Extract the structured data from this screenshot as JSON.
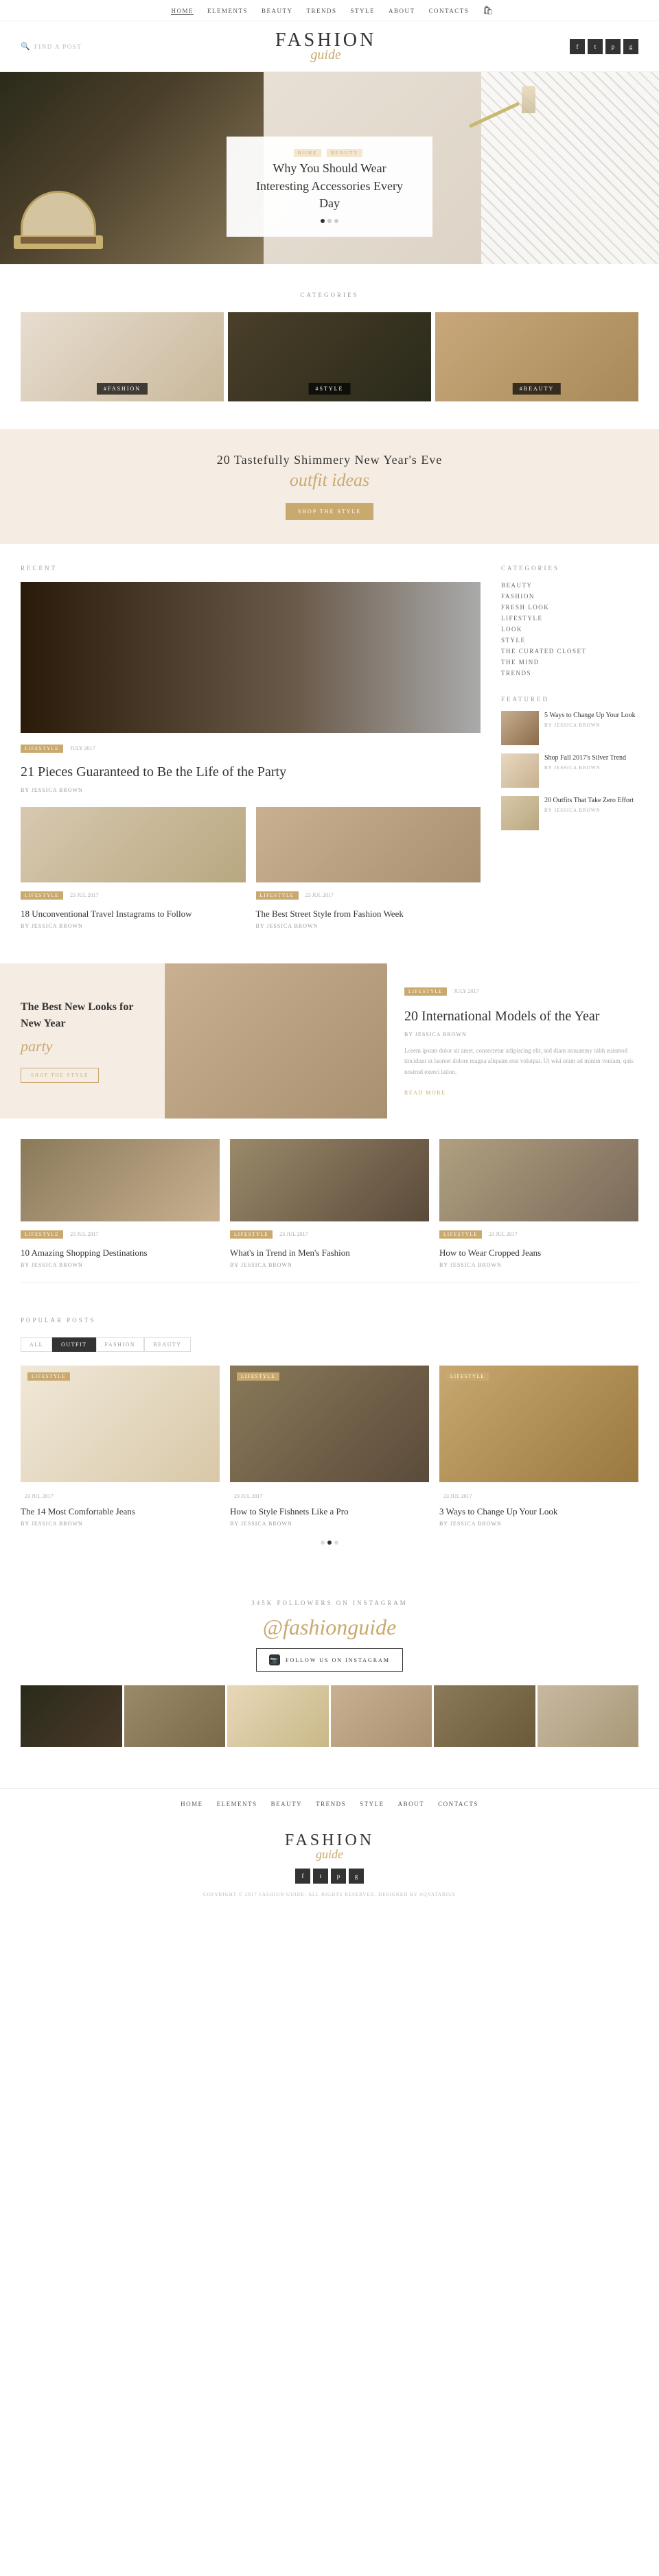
{
  "site": {
    "name": "FASHION",
    "script": "guide",
    "tagline": "345K FOLLOWERS ON INSTAGRAM",
    "instagram_handle": "@fashionguide"
  },
  "top_nav": {
    "items": [
      {
        "label": "HOME",
        "active": true
      },
      {
        "label": "ELEMENTS",
        "active": false
      },
      {
        "label": "BEAUTY",
        "active": false
      },
      {
        "label": "TRENDS",
        "active": false
      },
      {
        "label": "STYLE",
        "active": false
      },
      {
        "label": "ABOUT",
        "active": false
      },
      {
        "label": "CONTACTS",
        "active": false
      }
    ],
    "cart_icon": "🛍"
  },
  "header": {
    "search_placeholder": "FIND A POST",
    "social_icons": [
      "f",
      "t",
      "p",
      "g"
    ]
  },
  "hero": {
    "badge_home": "HOME",
    "badge_beauty": "BEAUTY",
    "title": "Why You Should Wear Interesting Accessories Every Day",
    "dots": 3,
    "active_dot": 0
  },
  "categories_section": {
    "label": "CATEGORIES",
    "items": [
      {
        "tag": "#FASHION",
        "color_class": "cat-img-fashion"
      },
      {
        "tag": "#STYLE",
        "color_class": "cat-img-style"
      },
      {
        "tag": "#BEAUTY",
        "color_class": "cat-img-beauty"
      }
    ]
  },
  "promo_banner": {
    "title": "20 Tastefully Shimmery New Year's Eve",
    "script": "outfit ideas",
    "button": "SHOP THE STYLE"
  },
  "recent_section": {
    "label": "RECENT",
    "featured_article": {
      "tag": "LIFESTYLE",
      "date": "JULY 2017",
      "title": "21 Pieces Guaranteed to Be the Life of the Party",
      "author": "BY JESSICA BROWN"
    },
    "two_col_articles": [
      {
        "tag": "LIFESTYLE",
        "date": "23 JUL 2017",
        "title": "18 Unconventional Travel Instagrams to Follow",
        "author": "BY JESSICA BROWN",
        "img_class": "img-travel"
      },
      {
        "tag": "LIFESTYLE",
        "date": "23 JUL 2017",
        "title": "The Best Street Style from Fashion Week",
        "author": "BY JESSICA BROWN",
        "img_class": "img-fashion"
      }
    ]
  },
  "sidebar": {
    "categories_label": "CATEGORIES",
    "categories": [
      "BEAUTY",
      "FASHION",
      "FRESH LOOK",
      "LIFESTYLE",
      "LOOK",
      "STYLE",
      "THE CURATED CLOSET",
      "THE MIND",
      "TRENDS"
    ],
    "featured_label": "FEATURED",
    "featured_items": [
      {
        "title": "5 Ways to Change Up Your Look",
        "author": "BY JESSICA BROWN",
        "thumb_class": "thumb-1"
      },
      {
        "title": "Shop Fall 2017's Silver Trend",
        "author": "BY JESSICA BROWN",
        "thumb_class": "thumb-2"
      },
      {
        "title": "20 Outfits That Take Zero Effort",
        "author": "BY JESSICA BROWN",
        "thumb_class": "thumb-3"
      }
    ]
  },
  "full_feature": {
    "promo_title": "The Best New Looks for New Year",
    "promo_script": "party",
    "promo_button": "SHOP THE STYLE",
    "article_tag": "LIFESTYLE",
    "article_date": "JULY 2017",
    "article_title": "20 International Models of the Year",
    "article_author": "BY JESSICA BROWN",
    "article_excerpt": "Lorem ipsum dolor sit amet, consectetur adipiscing elit, sed diam nonummy nibh euismod tincidunt ut laoreet dolore magna aliquam erat volutpat. Ut wisi enim ad minim veniam, quis nostrud exerci tation.",
    "read_more": "READ MORE"
  },
  "three_col_articles": [
    {
      "tag": "LIFESTYLE",
      "date": "23 JUL 2017",
      "title": "10 Amazing Shopping Destinations",
      "author": "BY JESSICA BROWN",
      "img_class": "img-col-1"
    },
    {
      "tag": "LIFESTYLE",
      "date": "23 JUL 2017",
      "title": "What's in Trend in Men's Fashion",
      "author": "BY JESSICA BROWN",
      "img_class": "img-col-2"
    },
    {
      "tag": "LIFESTYLE",
      "date": "23 JUL 2017",
      "title": "How to Wear Cropped Jeans",
      "author": "BY JESSICA BROWN",
      "img_class": "img-col-3"
    }
  ],
  "popular_section": {
    "label": "POPULAR POSTS",
    "tabs": [
      {
        "label": "ALL",
        "active": false
      },
      {
        "label": "OUTFIT",
        "active": true
      },
      {
        "label": "FASHION",
        "active": false
      },
      {
        "label": "BEAUTY",
        "active": false
      }
    ],
    "items": [
      {
        "tag": "LIFESTYLE",
        "date": "23 JUL 2017",
        "title": "The 14 Most Comfortable Jeans",
        "author": "BY JESSICA BROWN",
        "img_class": "pop-img-1"
      },
      {
        "tag": "LIFESTYLE",
        "date": "23 JUL 2017",
        "title": "How to Style Fishnets Like a Pro",
        "author": "BY JESSICA BROWN",
        "img_class": "pop-img-2"
      },
      {
        "tag": "LIFESTYLE",
        "date": "23 JUL 2017",
        "title": "3 Ways to Change Up Your Look",
        "author": "BY JESSICA BROWN",
        "img_class": "pop-img-3"
      }
    ],
    "pagination_dots": 3,
    "active_dot": 1
  },
  "instagram_section": {
    "followers_label": "345K FOLLOWERS ON INSTAGRAM",
    "handle": "@fashionguide",
    "follow_button": "FOLLOW US ON INSTAGRAM"
  },
  "footer": {
    "nav_items": [
      "HOME",
      "ELEMENTS",
      "BEAUTY",
      "TRENDS",
      "STYLE",
      "ABOUT",
      "CONTACTS"
    ],
    "logo_main": "FASHION",
    "logo_script": "guide",
    "social_icons": [
      "f",
      "t",
      "p",
      "g"
    ],
    "copyright": "COPYRIGHT © 2017 FASHION GUIDE. ALL RIGHTS RESERVED. DESIGNED BY AQVATARIUS"
  }
}
